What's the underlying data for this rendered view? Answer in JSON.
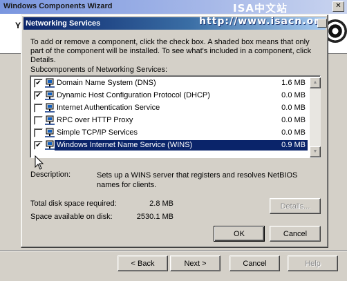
{
  "wizard": {
    "title": "Windows Components Wizard",
    "header_letter": "Y",
    "watermark_top": "ISA中文站",
    "buttons": {
      "back": "< Back",
      "next": "Next >",
      "cancel": "Cancel",
      "help": "Help"
    }
  },
  "dialog": {
    "title": "Networking Services",
    "watermark": "http://www.isacn.org",
    "instructions": "To add or remove a component, click the check box. A shaded box means that only part of the component will be installed. To see what's included in a component, click Details.",
    "subcomponents_label": "Subcomponents of Networking Services:",
    "items": [
      {
        "label": "Domain Name System (DNS)",
        "size": "1.6 MB",
        "checked": "✔",
        "selected": false
      },
      {
        "label": "Dynamic Host Configuration Protocol (DHCP)",
        "size": "0.0 MB",
        "checked": "✔",
        "selected": false
      },
      {
        "label": "Internet Authentication Service",
        "size": "0.0 MB",
        "checked": "",
        "selected": false
      },
      {
        "label": "RPC over HTTP Proxy",
        "size": "0.0 MB",
        "checked": "",
        "selected": false
      },
      {
        "label": "Simple TCP/IP Services",
        "size": "0.0 MB",
        "checked": "",
        "selected": false
      },
      {
        "label": "Windows Internet Name Service (WINS)",
        "size": "0.9 MB",
        "checked": "✔",
        "selected": true
      }
    ],
    "description_label": "Description:",
    "description_text": "Sets up a WINS server that registers and resolves NetBIOS names for clients.",
    "disk_required_label": "Total disk space required:",
    "disk_required_value": "2.8 MB",
    "disk_available_label": "Space available on disk:",
    "disk_available_value": "2530.1 MB",
    "buttons": {
      "details": "Details...",
      "ok": "OK",
      "cancel": "Cancel"
    }
  },
  "icons": {
    "component": "network-computer-icon",
    "close": "close-icon",
    "scroll_up": "scroll-up-arrow-icon",
    "scroll_down": "scroll-down-arrow-icon",
    "cursor": "mouse-cursor-icon",
    "logo": "windows-logo-icon"
  },
  "colors": {
    "selection": "#0a246a",
    "dialog_title_start": "#0a246a",
    "dialog_title_end": "#a6caf0",
    "face": "#d4d0c8"
  }
}
